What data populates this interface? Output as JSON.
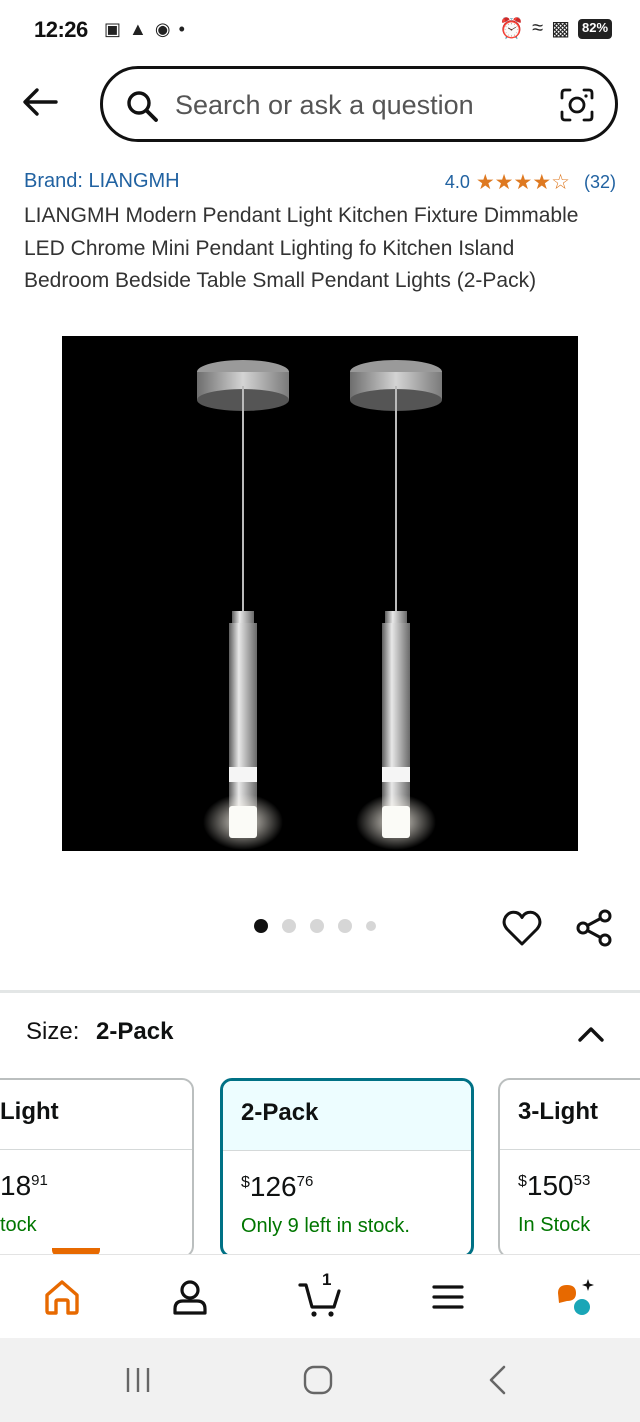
{
  "status_bar": {
    "time": "12:26",
    "battery": "82%"
  },
  "search": {
    "placeholder": "Search or ask a question"
  },
  "product": {
    "brand": "Brand: LIANGMH",
    "rating_value": "4.0",
    "rating_stars": 4,
    "rating_count": "(32)",
    "title": "LIANGMH Modern Pendant Light Kitchen Fixture Dimmable LED Chrome Mini Pendant Lighting fo Kitchen Island Bedroom Bedside Table Small Pendant Lights (2-Pack)"
  },
  "gallery": {
    "total_images": 5,
    "current_index": 1
  },
  "size": {
    "label": "Size:",
    "selected": "2-Pack"
  },
  "variants": [
    {
      "name": "Light",
      "price_whole": "18",
      "price_fraction": "91",
      "currency": "",
      "stock": "tock"
    },
    {
      "name": "2-Pack",
      "price_whole": "126",
      "price_fraction": "76",
      "currency": "$",
      "stock": "Only 9 left in stock."
    },
    {
      "name": "3-Light",
      "price_whole": "150",
      "price_fraction": "53",
      "currency": "$",
      "stock": "In Stock"
    }
  ],
  "bottom_nav": {
    "cart_count": "1",
    "items": [
      "home-icon",
      "account-icon",
      "cart-icon",
      "menu-icon",
      "rufus-assistant-icon"
    ]
  },
  "colors": {
    "link": "#2162a1",
    "star": "#de7921",
    "stock": "#007600",
    "selected_border": "#007185",
    "home_accent": "#e76900"
  }
}
